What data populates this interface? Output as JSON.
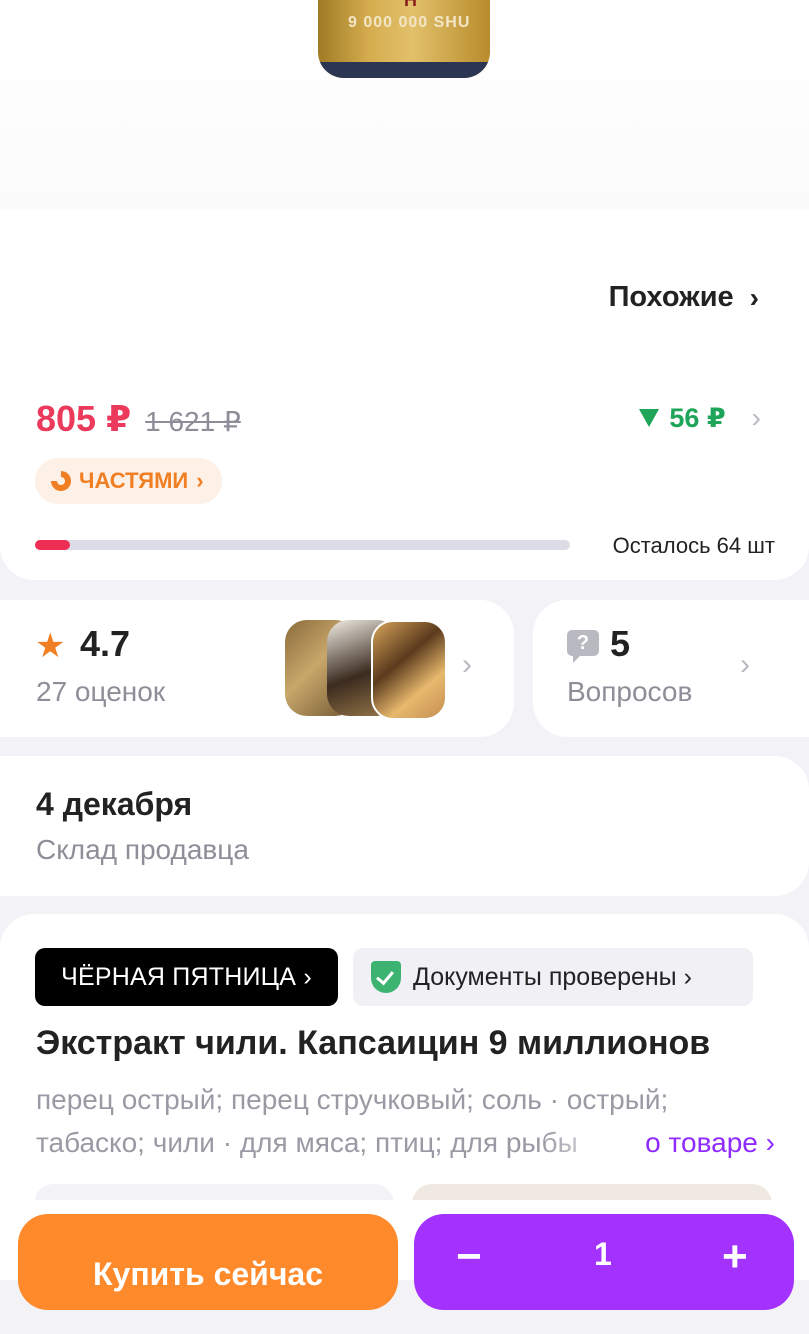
{
  "product_image": {
    "bottle_letter": "H",
    "label_text": "9 000 000 SHU"
  },
  "similar": {
    "label": "Похожие"
  },
  "price": {
    "current": "805 ₽",
    "old": "1 621 ₽",
    "cashback": "56 ₽",
    "installments_label": "ЧАСТЯМИ"
  },
  "stock": {
    "text": "Осталось 64 шт",
    "fill_fraction": 0.065
  },
  "rating": {
    "value": "4.7",
    "count_label": "27 оценок"
  },
  "questions": {
    "icon_glyph": "?",
    "count": "5",
    "label": "Вопросов"
  },
  "delivery": {
    "date": "4 декабря",
    "source": "Склад продавца"
  },
  "badges": {
    "black_friday": "ЧЁРНАЯ ПЯТНИЦА ›",
    "documents": "Документы проверены ›"
  },
  "product": {
    "title": "Экстракт чили. Капсаицин 9 миллионов",
    "tags": "перец острый; перец стручковый; соль · острый; табаско; чили · для мяса; птиц; для рыбы",
    "about_link": "о товаре ›"
  },
  "actions": {
    "buy_now": "Купить сейчас",
    "quantity": "1",
    "minus": "−",
    "plus": "+"
  },
  "colors": {
    "price_accent": "#ec3a5d",
    "cashback": "#1fa55a",
    "installments": "#f07f24",
    "buy_button": "#ff8a2c",
    "cart_button": "#a332ff",
    "link": "#8f2bff"
  },
  "icons": [
    "chevron-right-icon",
    "triangle-down-icon",
    "pie-icon",
    "star-icon",
    "question-icon",
    "shield-check-icon"
  ]
}
